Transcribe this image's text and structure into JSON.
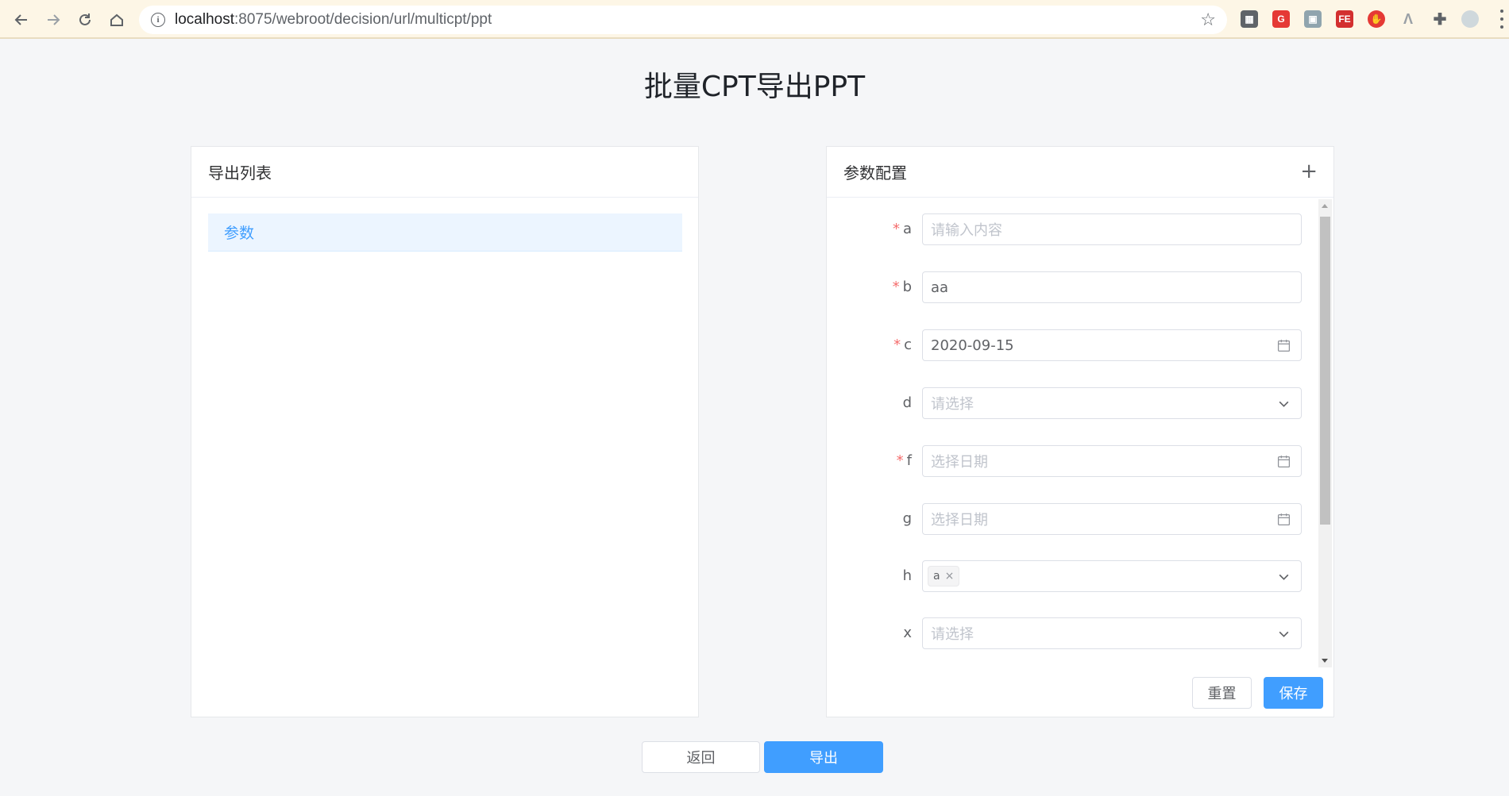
{
  "browser": {
    "url_host": "localhost",
    "url_path": ":8075/webroot/decision/url/multicpt/ppt"
  },
  "page": {
    "title": "批量CPT导出PPT"
  },
  "left_panel": {
    "title": "导出列表",
    "items": [
      "参数"
    ]
  },
  "right_panel": {
    "title": "参数配置",
    "add_label": "+",
    "fields": [
      {
        "label": "a",
        "required": true,
        "value": "",
        "placeholder": "请输入内容",
        "type": "input"
      },
      {
        "label": "b",
        "required": true,
        "value": "aa",
        "placeholder": "",
        "type": "input"
      },
      {
        "label": "c",
        "required": true,
        "value": "2020-09-15",
        "placeholder": "",
        "type": "date"
      },
      {
        "label": "d",
        "required": false,
        "value": "",
        "placeholder": "请选择",
        "type": "select"
      },
      {
        "label": "f",
        "required": true,
        "value": "",
        "placeholder": "选择日期",
        "type": "date"
      },
      {
        "label": "g",
        "required": false,
        "value": "",
        "placeholder": "选择日期",
        "type": "date"
      },
      {
        "label": "h",
        "required": false,
        "value": "",
        "tags": [
          "a"
        ],
        "placeholder": "",
        "type": "multiselect"
      },
      {
        "label": "x",
        "required": false,
        "value": "",
        "placeholder": "请选择",
        "type": "select"
      }
    ],
    "reset_label": "重置",
    "save_label": "保存"
  },
  "footer": {
    "back_label": "返回",
    "export_label": "导出"
  },
  "colors": {
    "primary": "#409eff",
    "required": "#f56c6c"
  }
}
